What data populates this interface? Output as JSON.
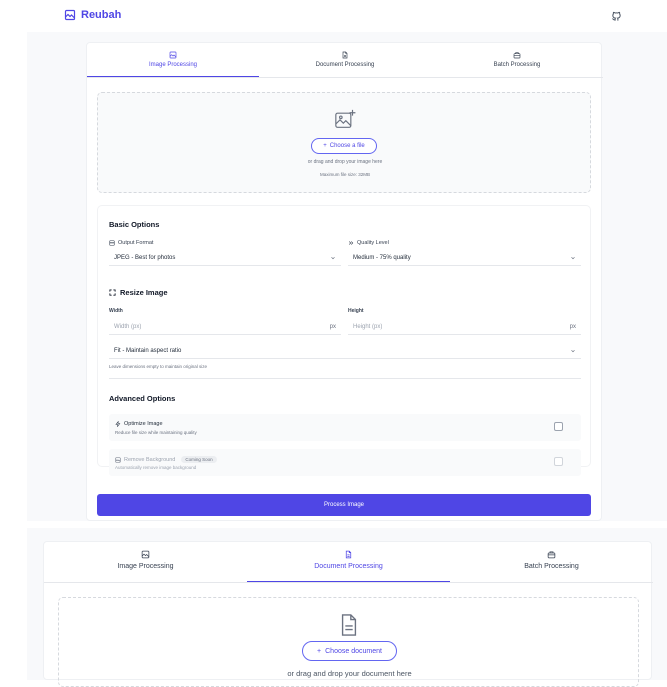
{
  "header": {
    "brand": "Reubah",
    "github_icon": "github-icon"
  },
  "panel1": {
    "tabs": [
      {
        "label": "Image Processing",
        "icon": "image-icon",
        "active": true
      },
      {
        "label": "Document Processing",
        "icon": "document-icon",
        "active": false
      },
      {
        "label": "Batch Processing",
        "icon": "briefcase-icon",
        "active": false
      }
    ],
    "upload": {
      "choose_label": "Choose a file",
      "drag_text": "or drag and drop your image here",
      "max_size": "Maximum file size: 32MB"
    },
    "basic": {
      "title": "Basic Options",
      "output_format_label": "Output Format",
      "output_format_value": "JPEG - Best for photos",
      "quality_label": "Quality Level",
      "quality_value": "Medium - 75% quality"
    },
    "resize": {
      "title": "Resize Image",
      "width_label": "Width",
      "width_placeholder": "Width (px)",
      "height_label": "Height",
      "height_placeholder": "Height (px)",
      "unit": "px",
      "fit_value": "Fit - Maintain aspect ratio",
      "hint": "Leave dimensions empty to maintain original size"
    },
    "advanced": {
      "title": "Advanced Options",
      "optimize_title": "Optimize Image",
      "optimize_desc": "Reduce file size while maintaining quality",
      "remove_bg_title": "Remove Background",
      "remove_bg_badge": "Coming Soon",
      "remove_bg_desc": "Automatically remove image background"
    },
    "process_label": "Process Image"
  },
  "panel2": {
    "tabs": [
      {
        "label": "Image Processing",
        "icon": "image-icon",
        "active": false
      },
      {
        "label": "Document Processing",
        "icon": "document-icon",
        "active": true
      },
      {
        "label": "Batch Processing",
        "icon": "briefcase-icon",
        "active": false
      }
    ],
    "upload": {
      "choose_label": "Choose document",
      "drag_text": "or drag and drop your document here"
    }
  },
  "colors": {
    "accent": "#4f46e5",
    "border": "#e5e7eb",
    "muted": "#6b7280"
  }
}
